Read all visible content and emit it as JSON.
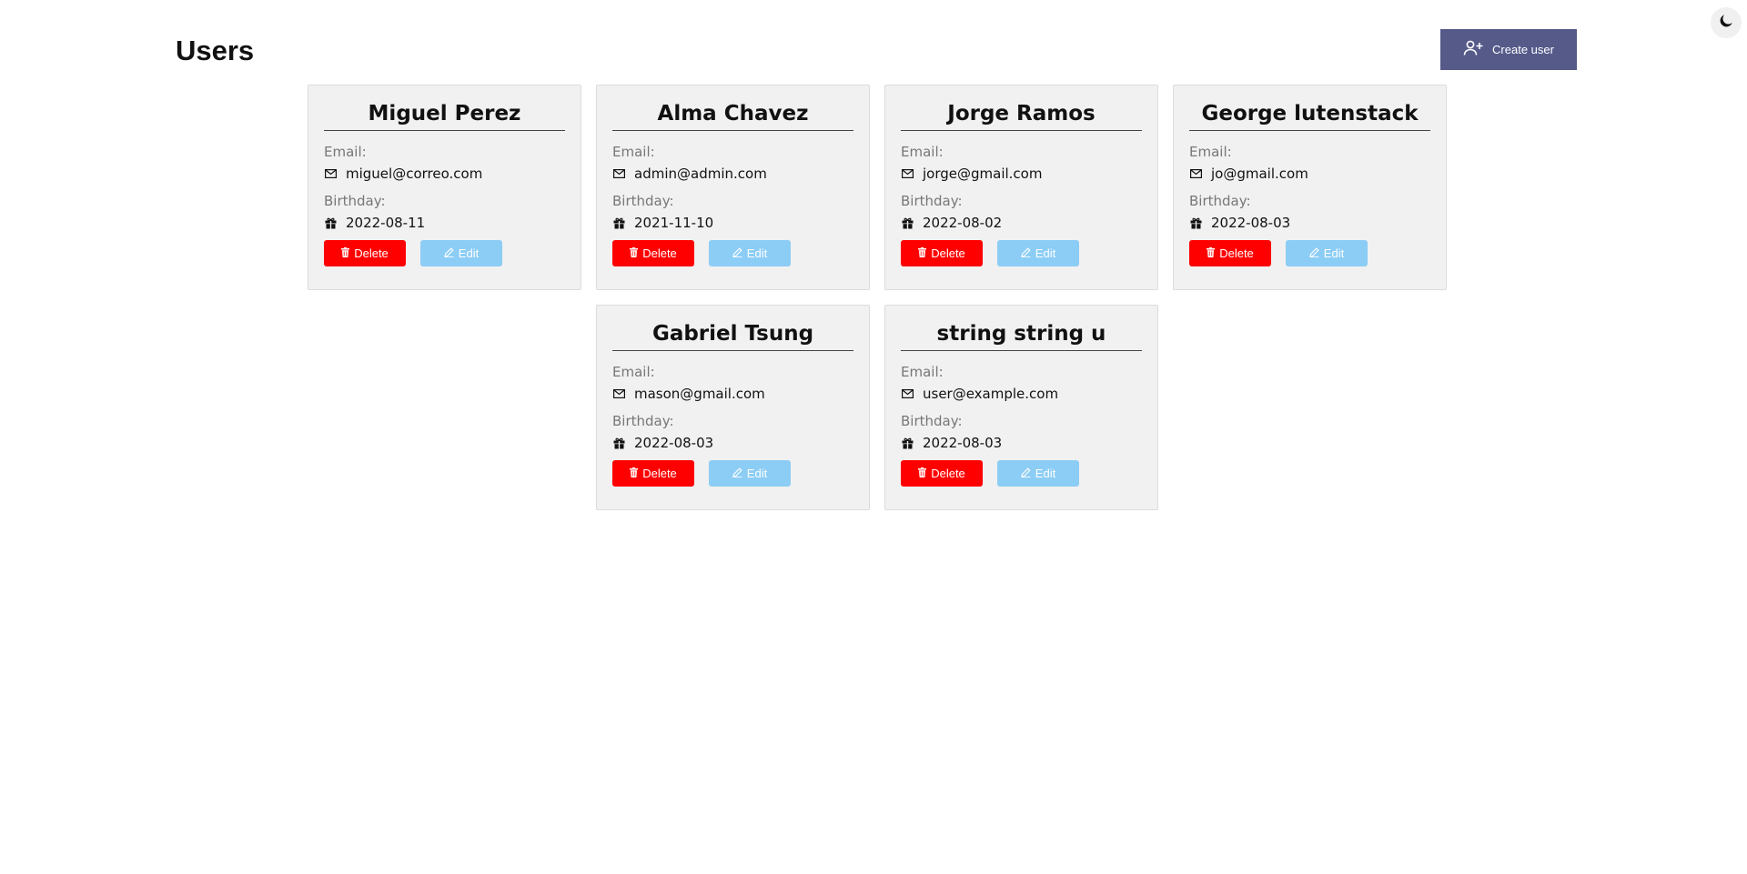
{
  "header": {
    "title": "Users",
    "create_label": "Create user"
  },
  "labels": {
    "email": "Email:",
    "birthday": "Birthday:",
    "delete": "Delete",
    "edit": "Edit"
  },
  "users": [
    {
      "name": "Miguel Perez",
      "email": "miguel@correo.com",
      "birthday": "2022-08-11"
    },
    {
      "name": "Alma Chavez",
      "email": "admin@admin.com",
      "birthday": "2021-11-10"
    },
    {
      "name": "Jorge Ramos",
      "email": "jorge@gmail.com",
      "birthday": "2022-08-02"
    },
    {
      "name": "George lutenstack",
      "email": "jo@gmail.com",
      "birthday": "2022-08-03"
    },
    {
      "name": "Gabriel Tsung",
      "email": "mason@gmail.com",
      "birthday": "2022-08-03"
    },
    {
      "name": "string string u",
      "email": "user@example.com",
      "birthday": "2022-08-03"
    }
  ],
  "colors": {
    "create_button": "#555a89",
    "delete_button": "#ff0000",
    "edit_button": "#8ccdf5",
    "card_background": "#f1f1f1"
  },
  "icons": {
    "theme_toggle": "moon-icon",
    "create": "user-plus-icon",
    "email": "envelope-icon",
    "birthday": "gift-icon",
    "delete": "trash-icon",
    "edit": "pencil-icon"
  }
}
